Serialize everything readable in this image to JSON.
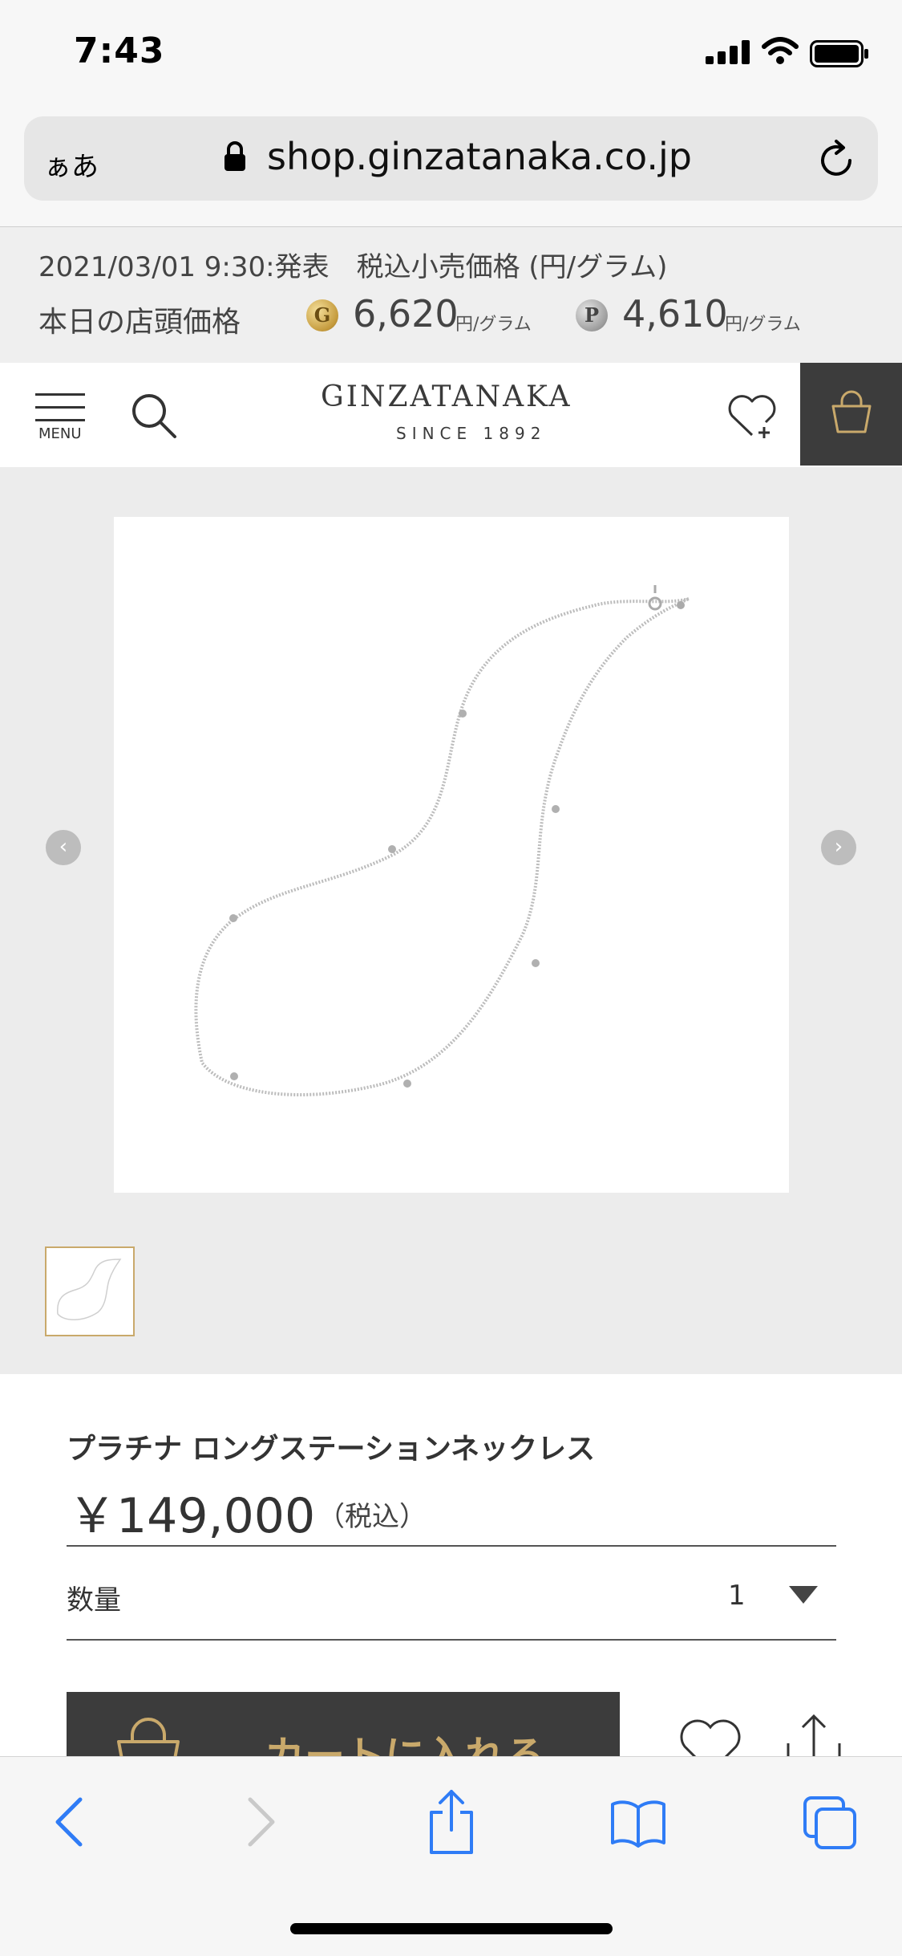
{
  "status_bar": {
    "time": "7:43"
  },
  "address_bar": {
    "text_size_label": "ぁあ",
    "url": "shop.ginzatanaka.co.jp"
  },
  "price_band": {
    "date_line": "2021/03/01 9:30:発表　税込小売価格 (円/グラム)",
    "store_price_label": "本日の店頭価格",
    "gold": {
      "coin_letter": "G",
      "price": "6,620",
      "unit": "円/グラム"
    },
    "platinum": {
      "coin_letter": "P",
      "price": "4,610",
      "unit": "円/グラム"
    }
  },
  "header": {
    "menu_label": "MENU",
    "logo": "GINZATANAKA",
    "logo_sub": "SINCE 1892"
  },
  "gallery": {
    "prev_glyph": "‹",
    "next_glyph": "›"
  },
  "product": {
    "name": "プラチナ ロングステーションネックレス",
    "price": "￥149,000",
    "tax_label": "（税込）",
    "quantity_label": "数量",
    "quantity_value": "1",
    "add_to_cart_label": "カートに入れる"
  },
  "colors": {
    "accent_gold": "#c9a96b",
    "dark_button": "#3c3c3c",
    "safari_blue": "#2f7cf6"
  },
  "icons": [
    "signal-icon",
    "wifi-icon",
    "battery-icon",
    "lock-icon",
    "reload-icon",
    "menu-icon",
    "search-icon",
    "favorite-icon",
    "shopping-bag-icon",
    "share-icon",
    "back-icon",
    "forward-icon",
    "bookmarks-icon",
    "tabs-icon"
  ]
}
